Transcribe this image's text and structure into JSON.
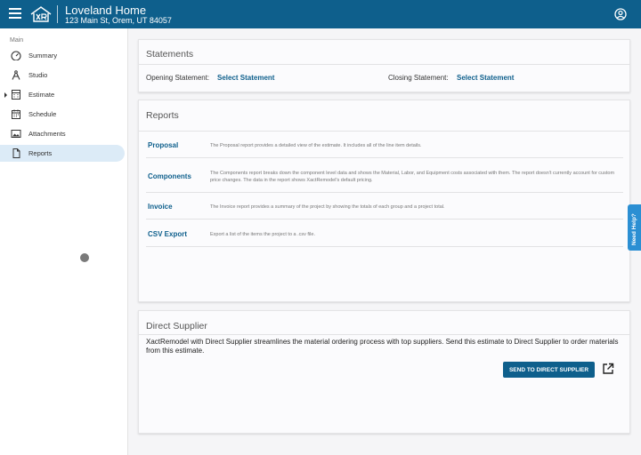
{
  "header": {
    "project_name": "Loveland Home",
    "project_address": "123 Main St, Orem, UT 84057"
  },
  "sidebar": {
    "section": "Main",
    "items": [
      {
        "label": "Summary",
        "icon": "gauge-icon"
      },
      {
        "label": "Studio",
        "icon": "compass-icon"
      },
      {
        "label": "Estimate",
        "icon": "calculator-icon"
      },
      {
        "label": "Schedule",
        "icon": "calendar-icon"
      },
      {
        "label": "Attachments",
        "icon": "image-icon"
      },
      {
        "label": "Reports",
        "icon": "document-icon"
      }
    ],
    "active": "Reports"
  },
  "statements": {
    "title": "Statements",
    "opening_label": "Opening Statement:",
    "opening_link": "Select Statement",
    "closing_label": "Closing Statement:",
    "closing_link": "Select Statement"
  },
  "reports": {
    "title": "Reports",
    "items": [
      {
        "name": "Proposal",
        "description": "The Proposal report provides a detailed view of the estimate. It includes all of the line item details."
      },
      {
        "name": "Components",
        "description": "The Components report breaks down the component level data and shows the Material, Labor, and Equipment costs associated with them. The report doesn't currently account for custom price changes. The data in the report shows XactRemodel's default pricing."
      },
      {
        "name": "Invoice",
        "description": "The Invoice report provides a summary of the project by showing the totals of each group and a project total."
      },
      {
        "name": "CSV Export",
        "description": "Export a list of the items the project to a .csv file."
      }
    ]
  },
  "direct_supplier": {
    "title": "Direct Supplier",
    "text": "XactRemodel with Direct Supplier streamlines the material ordering process with top suppliers. Send this estimate to Direct Supplier to order materials from this estimate.",
    "button": "SEND TO DIRECT SUPPLIER"
  },
  "help_tab": "Need Help?",
  "colors": {
    "brand": "#0e5f8c",
    "active_nav": "#dcebf7",
    "help_tab": "#2b8fd3"
  }
}
